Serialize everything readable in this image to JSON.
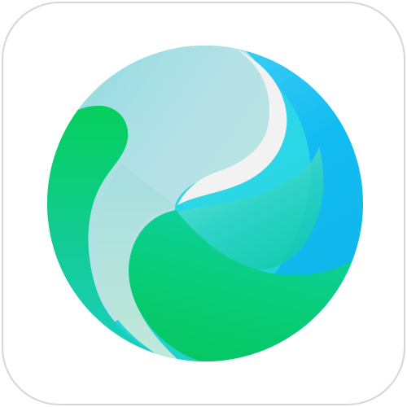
{
  "icon": {
    "name": "swirl-globe-app-icon",
    "colors": {
      "tile_background": "#ffffff",
      "tile_border": "#d6d6d6",
      "sky_blue": "#12bcf2",
      "cyan": "#35d6f2",
      "aqua_light": "#a9dfe6",
      "teal": "#1bcdbf",
      "green": "#07c96a",
      "green_light": "#b6e6cf",
      "swirl_white": "#f2f2f2"
    }
  }
}
